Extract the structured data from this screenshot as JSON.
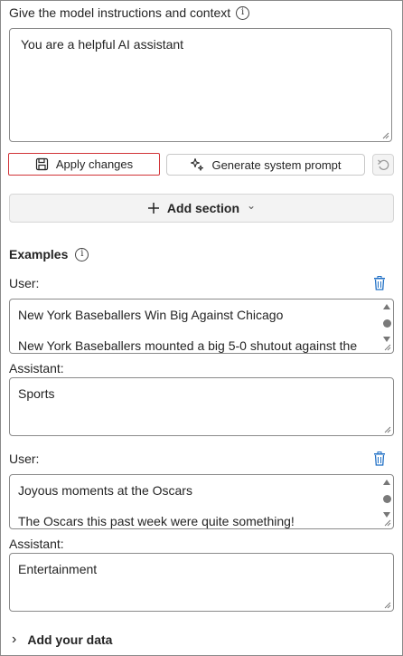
{
  "system": {
    "heading": "Give the model instructions and context",
    "info_glyph": "i",
    "value": "You are a helpful AI assistant"
  },
  "actions": {
    "apply_label": "Apply changes",
    "generate_label": "Generate system prompt",
    "apply_outline_color": "#d13438"
  },
  "add_section": {
    "label": "Add section",
    "chevron": "⌄"
  },
  "examples": {
    "heading": "Examples",
    "items": [
      {
        "user_label": "User:",
        "user_line1": "New York Baseballers Win Big Against Chicago",
        "user_line2": "New York Baseballers mounted a big 5-0 shutout against the",
        "assistant_label": "Assistant:",
        "assistant_value": "Sports"
      },
      {
        "user_label": "User:",
        "user_line1": "Joyous moments at the Oscars",
        "user_line2": "The Oscars this past week were quite something!",
        "assistant_label": "Assistant:",
        "assistant_value": "Entertainment"
      }
    ]
  },
  "add_data": {
    "label": "Add your data",
    "chevron": "›"
  },
  "icons": {
    "trash_color": "#1f6fc5"
  }
}
